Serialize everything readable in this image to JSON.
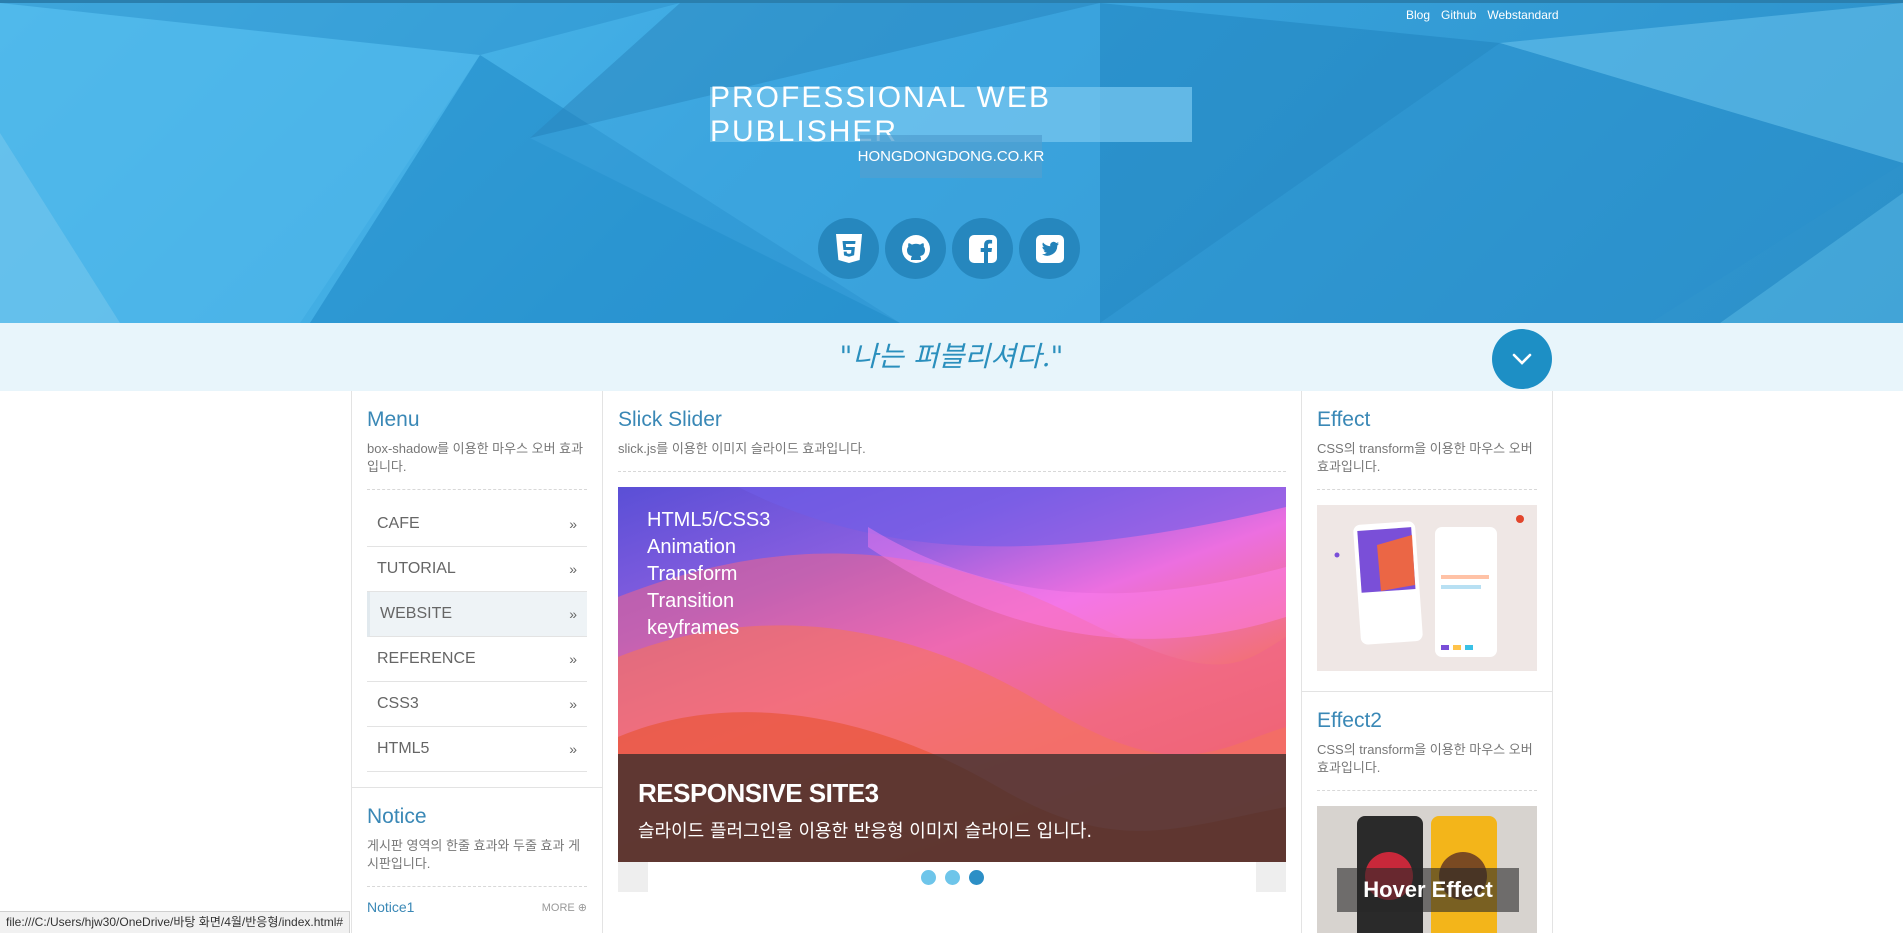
{
  "header": {
    "nav": [
      "Blog",
      "Github",
      "Webstandard"
    ],
    "title": "PROFESSIONAL WEB PUBLISHER",
    "domain": "HONGDONGDONG.CO.KR",
    "socials": [
      "html5-icon",
      "github-icon",
      "facebook-icon",
      "twitter-icon"
    ]
  },
  "slogan": {
    "text": "\"나는 퍼블리셔다.\""
  },
  "menu_section": {
    "title": "Menu",
    "desc": "box-shadow를 이용한 마우스 오버 효과입니다.",
    "items": [
      {
        "label": "CAFE"
      },
      {
        "label": "TUTORIAL"
      },
      {
        "label": "WEBSITE"
      },
      {
        "label": "REFERENCE"
      },
      {
        "label": "CSS3"
      },
      {
        "label": "HTML5"
      }
    ],
    "active_index": 2
  },
  "notice_section": {
    "title": "Notice",
    "desc": "게시판 영역의 한줄 효과와 두줄 효과 게시판입니다.",
    "first_item": "Notice1",
    "more": "MORE"
  },
  "slider_section": {
    "title": "Slick Slider",
    "desc": "slick.js를 이용한 이미지 슬라이드 효과입니다.",
    "slide_list": [
      "HTML5/CSS3",
      "Animation",
      "Transform",
      "Transition",
      "keyframes"
    ],
    "caption_title": "RESPONSIVE SITE3",
    "caption_text": "슬라이드 플러그인을 이용한 반응형 이미지 슬라이드 입니다.",
    "active_dot": 2,
    "dot_count": 3
  },
  "effect_section": {
    "title": "Effect",
    "desc": "CSS의 transform을 이용한 마우스 오버 효과입니다."
  },
  "effect2_section": {
    "title": "Effect2",
    "desc": "CSS의 transform을 이용한 마우스 오버 효과입니다.",
    "hover_label": "Hover Effect"
  },
  "statusbar": {
    "url": "file:///C:/Users/hjw30/OneDrive/바탕 화면/4월/반응형/index.html#"
  },
  "colors": {
    "accent": "#2c8fc6",
    "header_dark": "#2b8fc8",
    "slogan_bg": "#e8f5fb"
  }
}
